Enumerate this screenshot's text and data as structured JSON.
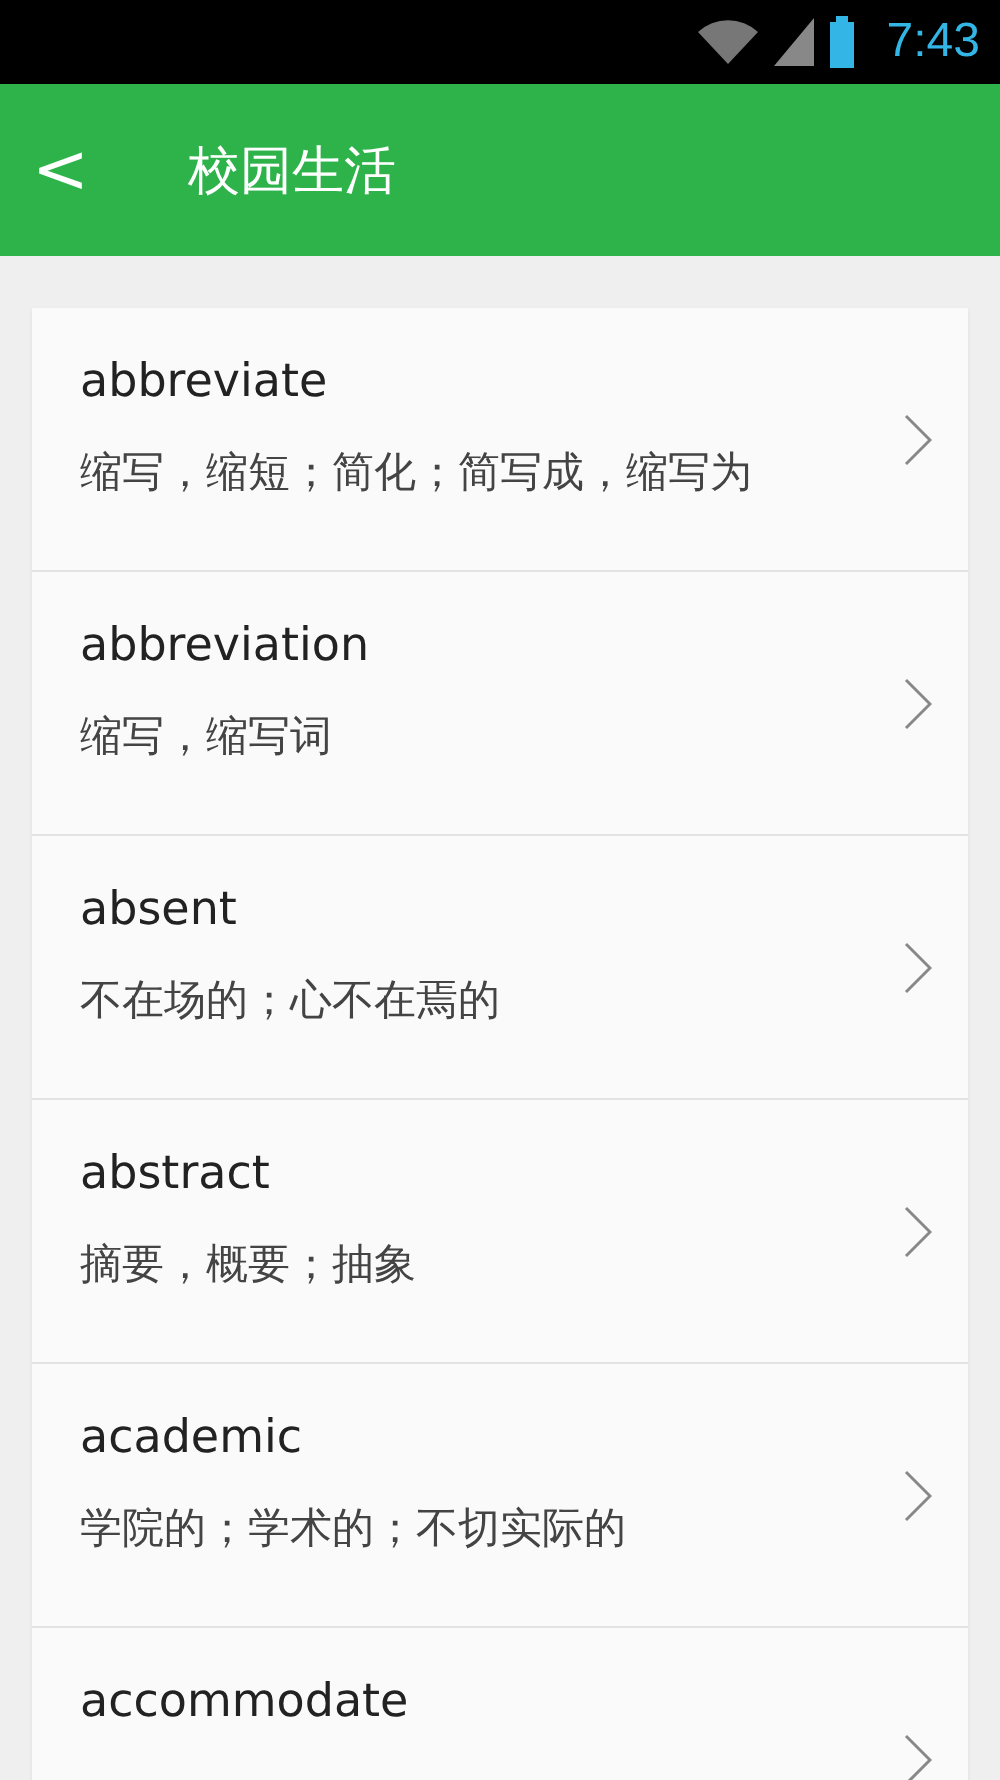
{
  "status_bar": {
    "time": "7:43"
  },
  "header": {
    "back": "<",
    "title": "校园生活"
  },
  "words": [
    {
      "word": "abbreviate",
      "meaning": "缩写，缩短；简化；简写成，缩写为"
    },
    {
      "word": "abbreviation",
      "meaning": "缩写，缩写词"
    },
    {
      "word": "absent",
      "meaning": "不在场的；心不在焉的"
    },
    {
      "word": "abstract",
      "meaning": "摘要，概要；抽象"
    },
    {
      "word": "academic",
      "meaning": "学院的；学术的；不切实际的"
    },
    {
      "word": "accommodate"
    }
  ]
}
